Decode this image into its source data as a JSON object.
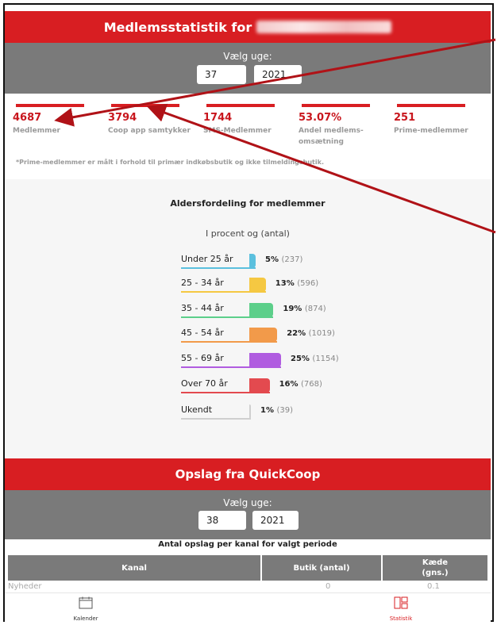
{
  "members_header": {
    "title": "Medlemsstatistik for"
  },
  "week_picker_1": {
    "label": "Vælg uge:",
    "week": "37",
    "year": "2021"
  },
  "stats": [
    {
      "value": "4687",
      "label": "Medlemmer"
    },
    {
      "value": "3794",
      "label": "Coop app samtykker"
    },
    {
      "value": "1744",
      "label": "SMS-Medlemmer"
    },
    {
      "value": "53.07%",
      "label": "Andel medlems-omsætning"
    },
    {
      "value": "251",
      "label": "Prime-medlemmer"
    }
  ],
  "footnote": "*Prime-medlemmer er målt i forhold til primær indkøbsbutik og ikke tilmeldingsbutik.",
  "age_chart": {
    "title": "Aldersfordeling for medlemmer",
    "subtitle": "I procent og (antal)",
    "rows": [
      {
        "category": "Under 25 år",
        "percent_label": "5%",
        "count_label": "(237)",
        "percent": 5,
        "color": "#5bc0de"
      },
      {
        "category": "25 - 34 år",
        "percent_label": "13%",
        "count_label": "(596)",
        "percent": 13,
        "color": "#f5c842"
      },
      {
        "category": "35 - 44 år",
        "percent_label": "19%",
        "count_label": "(874)",
        "percent": 19,
        "color": "#5ccf8a"
      },
      {
        "category": "45 - 54 år",
        "percent_label": "22%",
        "count_label": "(1019)",
        "percent": 22,
        "color": "#f29a4a"
      },
      {
        "category": "55 - 69 år",
        "percent_label": "25%",
        "count_label": "(1154)",
        "percent": 25,
        "color": "#b05ce0"
      },
      {
        "category": "Over 70 år",
        "percent_label": "16%",
        "count_label": "(768)",
        "percent": 16,
        "color": "#e34a4f"
      },
      {
        "category": "Ukendt",
        "percent_label": "1%",
        "count_label": "(39)",
        "percent": 1,
        "color": "#cfcfcf"
      }
    ]
  },
  "quickcoop": {
    "title": "Opslag fra QuickCoop",
    "week_label": "Vælg uge:",
    "week": "38",
    "year": "2021",
    "table_caption": "Antal opslag per kanal for valgt periode",
    "columns": [
      "Kanal",
      "Butik (antal)",
      "Kæde (gns.)"
    ],
    "rows": [
      {
        "kanal": "Nyheder",
        "butik": "0",
        "kaede": "0.1"
      }
    ]
  },
  "nav": {
    "calendar_label": "Kalender",
    "stats_label": "Statistik"
  },
  "colors": {
    "brand_red": "#d81e22",
    "header_grey": "#7a7a7a",
    "annotation_arrow": "#b01217"
  }
}
